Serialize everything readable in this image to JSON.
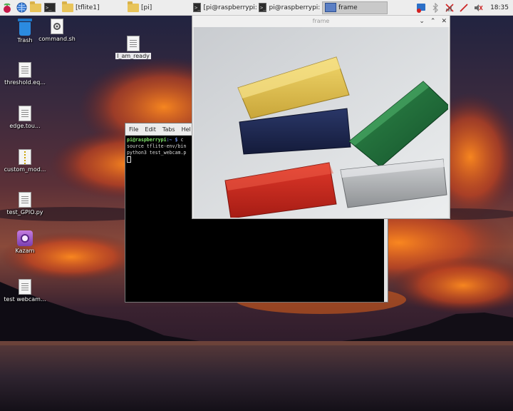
{
  "panel": {
    "tasks": [
      {
        "label": "[tflite1]"
      },
      {
        "label": "[pi]"
      },
      {
        "label": "[pi@raspberrypi:..."
      },
      {
        "label": "pi@raspberrypi: ~"
      },
      {
        "label": "frame"
      }
    ],
    "clock": "18:35"
  },
  "desktop_icons": [
    {
      "label": "Trash"
    },
    {
      "label": "command.sh"
    },
    {
      "label": "I_am_ready"
    },
    {
      "label": "threshold.eq..."
    },
    {
      "label": "edge.tou..."
    },
    {
      "label": "custom_mod..."
    },
    {
      "label": "test_GPIO.py"
    },
    {
      "label": "Kazam"
    },
    {
      "label": "test webcam..."
    }
  ],
  "terminal": {
    "menu": [
      "File",
      "Edit",
      "Tabs",
      "Hel"
    ],
    "prompt_user": "pi@raspberrypi",
    "prompt_path": ":~ $",
    "command1": " c",
    "line2": "source tflite-env/bin",
    "line3": "python3 test_webcam.p"
  },
  "frame": {
    "title": "frame",
    "min_glyph": "⌄",
    "max_glyph": "⌃",
    "close_glyph": "✕"
  }
}
